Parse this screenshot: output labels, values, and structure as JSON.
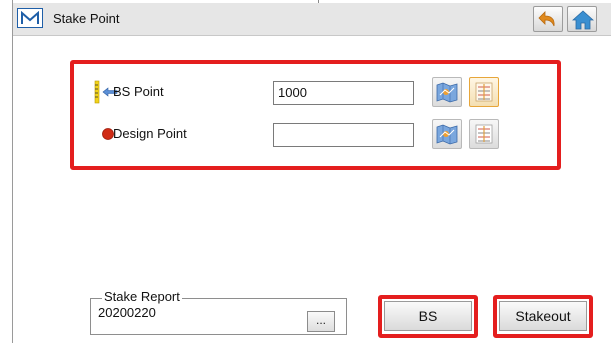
{
  "window": {
    "title": "Stake Point",
    "logo_letter": "M"
  },
  "toolbar": {
    "back_icon": "undo-arrow-icon",
    "home_icon": "home-icon"
  },
  "points": {
    "bs_point": {
      "label": "BS Point",
      "value": "1000",
      "icon": "backsight-target-icon"
    },
    "design_point": {
      "label": "Design Point",
      "value": "",
      "icon": "red-dot-icon"
    },
    "map_button_icon": "map-select-icon",
    "list_button_icon": "point-list-icon"
  },
  "stake_report": {
    "title": "Stake Report",
    "value": "20200220",
    "browse_label": "..."
  },
  "buttons": {
    "bs_label": "BS",
    "stakeout_label": "Stakeout"
  },
  "colors": {
    "highlight": "#e41e1e",
    "titlebar": "#e6e6e6",
    "logo_blue": "#1f5fa8",
    "home_blue": "#3a8fd1",
    "back_orange": "#e08a1e"
  }
}
